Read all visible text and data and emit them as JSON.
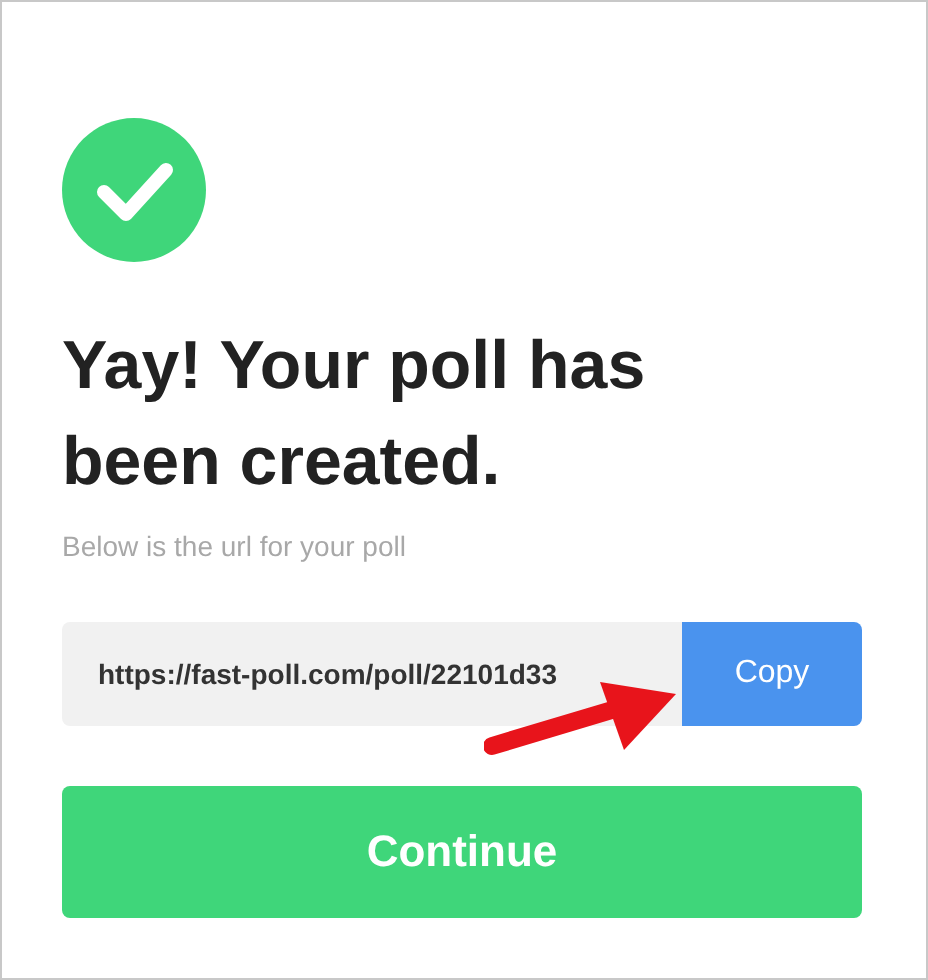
{
  "title": "Yay! Your poll has been created.",
  "subtitle": "Below is the url for your poll",
  "url_field": {
    "value": "https://fast-poll.com/poll/22101d33"
  },
  "copy_button": {
    "label": "Copy"
  },
  "continue_button": {
    "label": "Continue"
  }
}
